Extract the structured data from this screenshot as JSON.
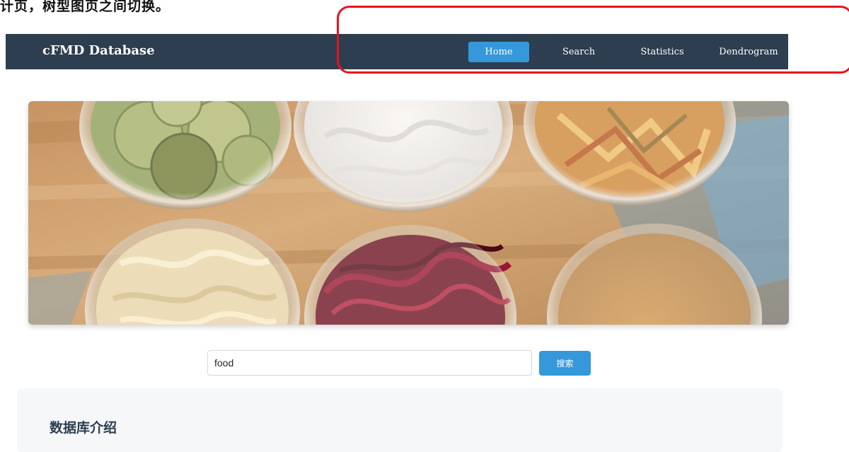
{
  "caption": {
    "text": "计页，树型图页之间切换。"
  },
  "navbar": {
    "brand": "cFMD Database",
    "items": [
      {
        "label": "Home",
        "active": true
      },
      {
        "label": "Search",
        "active": false
      },
      {
        "label": "Statistics",
        "active": false
      },
      {
        "label": "Dendrogram",
        "active": false
      }
    ],
    "background_color": "#2c3e50",
    "active_color": "#3498db"
  },
  "hero": {
    "image_subject": "fermented foods in glass bowls on wooden table"
  },
  "search": {
    "value": "food",
    "button_label": "搜索"
  },
  "intro": {
    "title": "数据库介绍"
  },
  "annotation": {
    "color": "#e8131d"
  }
}
